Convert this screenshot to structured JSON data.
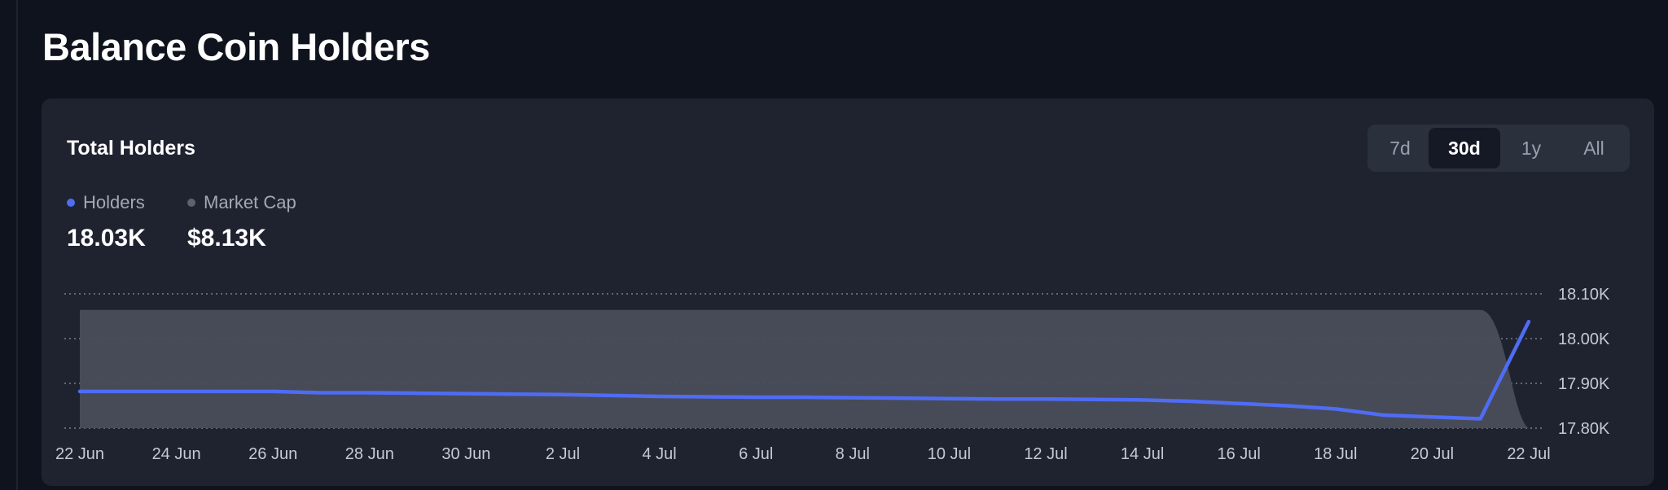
{
  "page": {
    "title": "Balance Coin Holders"
  },
  "card": {
    "title": "Total Holders",
    "ranges": [
      {
        "label": "7d",
        "active": false
      },
      {
        "label": "30d",
        "active": true
      },
      {
        "label": "1y",
        "active": false
      },
      {
        "label": "All",
        "active": false
      }
    ],
    "legend": [
      {
        "label": "Holders",
        "value": "18.03K",
        "color": "#4f6cf5"
      },
      {
        "label": "Market Cap",
        "value": "$8.13K",
        "color": "#5d6270"
      }
    ]
  },
  "colors": {
    "background": "#0e131e",
    "card": "#1f2330",
    "holders_line": "#4f6cf5",
    "market_cap_area": "#4a4e5a",
    "gridline": "#8c909a"
  },
  "chart_data": {
    "type": "line",
    "x_tick_labels": [
      "22 Jun",
      "24 Jun",
      "26 Jun",
      "28 Jun",
      "30 Jun",
      "2 Jul",
      "4 Jul",
      "6 Jul",
      "8 Jul",
      "10 Jul",
      "12 Jul",
      "14 Jul",
      "16 Jul",
      "18 Jul",
      "20 Jul",
      "22 Jul"
    ],
    "y_tick_labels": [
      "18.10K",
      "18.00K",
      "17.90K",
      "17.80K"
    ],
    "y_ticks": [
      18100,
      18000,
      17900,
      17800
    ],
    "ylim": [
      17800,
      18100
    ],
    "x": [
      "22 Jun",
      "23 Jun",
      "24 Jun",
      "25 Jun",
      "26 Jun",
      "27 Jun",
      "28 Jun",
      "29 Jun",
      "30 Jun",
      "1 Jul",
      "2 Jul",
      "3 Jul",
      "4 Jul",
      "5 Jul",
      "6 Jul",
      "7 Jul",
      "8 Jul",
      "9 Jul",
      "10 Jul",
      "11 Jul",
      "12 Jul",
      "13 Jul",
      "14 Jul",
      "15 Jul",
      "16 Jul",
      "17 Jul",
      "18 Jul",
      "19 Jul",
      "20 Jul",
      "21 Jul",
      "22 Jul"
    ],
    "series": [
      {
        "name": "Holders",
        "style": "line",
        "axis": "right",
        "values": [
          17882,
          17882,
          17882,
          17882,
          17882,
          17879,
          17879,
          17878,
          17877,
          17876,
          17875,
          17873,
          17871,
          17870,
          17869,
          17869,
          17868,
          17867,
          17866,
          17865,
          17865,
          17864,
          17863,
          17860,
          17855,
          17850,
          17843,
          17829,
          17825,
          17821,
          18038
        ]
      },
      {
        "name": "Market Cap",
        "style": "area",
        "note_values_relative": true,
        "values": [
          0.88,
          0.88,
          0.88,
          0.88,
          0.88,
          0.88,
          0.88,
          0.88,
          0.88,
          0.88,
          0.88,
          0.88,
          0.88,
          0.88,
          0.88,
          0.88,
          0.88,
          0.88,
          0.88,
          0.88,
          0.88,
          0.88,
          0.88,
          0.88,
          0.88,
          0.88,
          0.88,
          0.88,
          0.88,
          0.88,
          0.0
        ]
      }
    ],
    "grid": true,
    "grid_style": "dotted-horizontal",
    "legend": "top-left"
  }
}
